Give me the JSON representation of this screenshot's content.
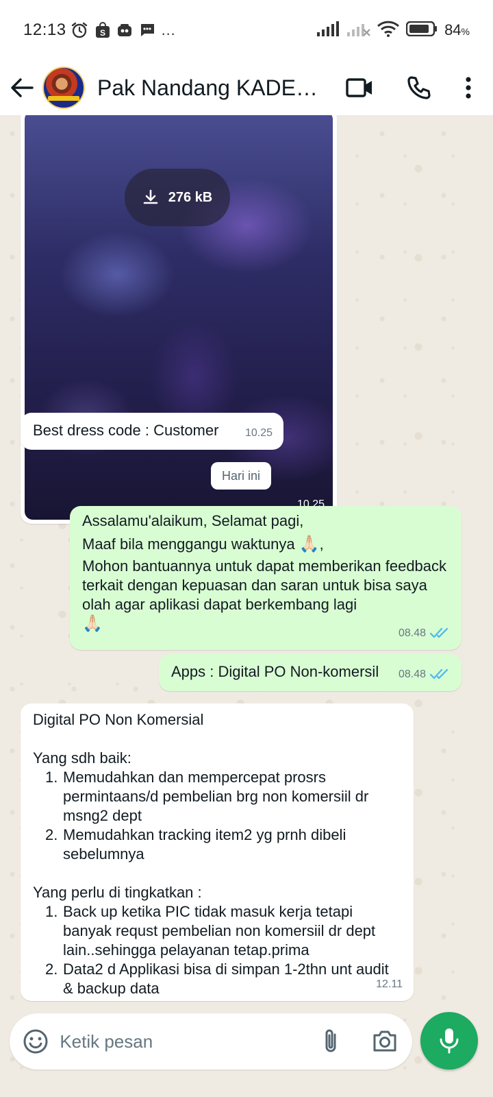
{
  "status_bar": {
    "time": "12:13",
    "notification_icons": [
      "alarm-icon",
      "shopee-icon",
      "bag-icon",
      "chat-icon"
    ],
    "more_dots": "…",
    "battery_percent": "84",
    "battery_unit": "%"
  },
  "header": {
    "contact_name": "Pak Nandang KADEP...",
    "icons": [
      "back-arrow-icon",
      "video-call-icon",
      "voice-call-icon",
      "more-vert-icon"
    ]
  },
  "messages": {
    "image": {
      "download_size": "276 kB",
      "time": "10.25"
    },
    "caption": {
      "text": "Best dress code : Customer",
      "time": "10.25"
    },
    "day_separator": "Hari ini",
    "out_1": {
      "line1": "Assalamu'alaikum, Selamat pagi,",
      "line2": "Maaf bila menggangu waktunya",
      "line2_suffix": ",",
      "line3": "Mohon bantuannya untuk dapat memberikan feedback terkait dengan kepuasan dan saran untuk bisa saya olah agar aplikasi dapat berkembang lagi",
      "emoji": "🙏🏻",
      "time": "08.48"
    },
    "out_2": {
      "text": "Apps : Digital PO Non-komersil",
      "time": "08.48"
    },
    "in_long": {
      "title": "Digital PO Non Komersial",
      "section1": "Yang sdh baik:",
      "section1_items": [
        {
          "num": "1.",
          "text": "Memudahkan  dan mempercepat prosrs permintaans/d pembelian brg non komersiil dr msng2  dept"
        },
        {
          "num": "2.",
          "text": "Memudahkan tracking item2 yg prnh dibeli sebelumnya"
        }
      ],
      "section2": "Yang perlu di tingkatkan :",
      "section2_items": [
        {
          "num": "1.",
          "text": "Back up  ketika PIC tidak masuk kerja tetapi banyak requst  pembelian non komersiil dr dept lain..sehingga pelayanan tetap.prima"
        },
        {
          "num": "2.",
          "text": "Data2 d Applikasi bisa  di simpan 1-2thn unt audit & backup data"
        }
      ],
      "time": "12.11"
    }
  },
  "input_bar": {
    "placeholder": "Ketik pesan",
    "value": ""
  },
  "colors": {
    "accent_green": "#1daa61",
    "outgoing_bubble": "#d9fdd3",
    "read_tick": "#53bdeb",
    "chat_background": "#efeae2"
  }
}
